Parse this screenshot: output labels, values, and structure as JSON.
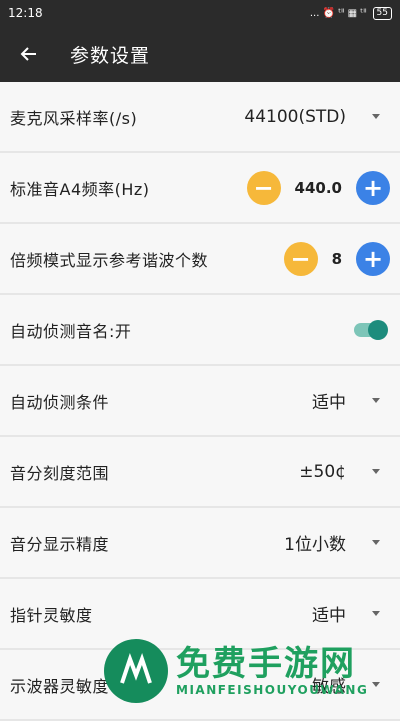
{
  "status": {
    "time": "12:18",
    "indicators": "... ⏰ ᵗˡˡ ▦ ᵗˡˡ",
    "battery": "55"
  },
  "appbar": {
    "title": "参数设置"
  },
  "settings": [
    {
      "label": "麦克风采样率(/s)",
      "value": "44100(STD)"
    },
    {
      "label": "标准音A4频率(Hz)",
      "value": "440.0"
    },
    {
      "label": "倍频模式显示参考谐波个数",
      "value": "8"
    },
    {
      "label": "自动侦测音名:开",
      "toggle_on": true
    },
    {
      "label": "自动侦测条件",
      "value": "适中"
    },
    {
      "label": "音分刻度范围",
      "value": "±50¢"
    },
    {
      "label": "音分显示精度",
      "value": "1位小数"
    },
    {
      "label": "指针灵敏度",
      "value": "适中"
    },
    {
      "label": "示波器灵敏度",
      "value": "敏感"
    }
  ],
  "watermark": {
    "cn": "免费手游网",
    "en": "MIANFEISHOUYOUWANG"
  },
  "colors": {
    "accent_minus": "#f6b83a",
    "accent_plus": "#3b82e6",
    "toggle": "#1d8c7d",
    "appbar": "#2b2b2b"
  }
}
